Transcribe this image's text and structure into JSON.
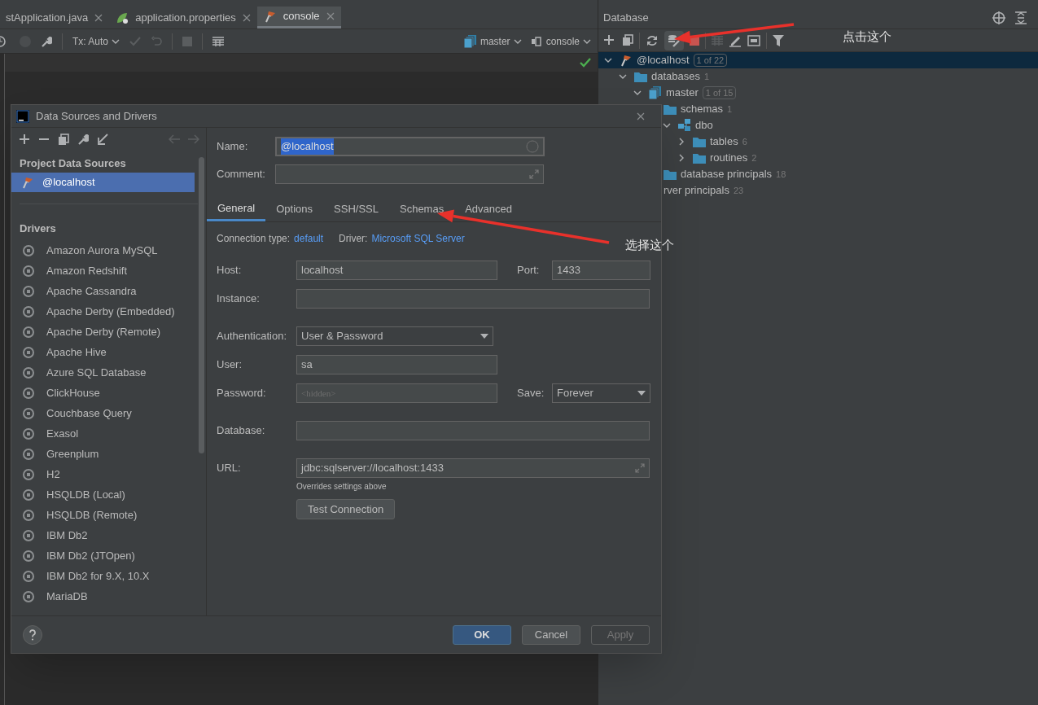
{
  "editor": {
    "tabs": [
      {
        "label": "stApplication.java",
        "kind": "java",
        "selected": false
      },
      {
        "label": "application.properties",
        "kind": "spring",
        "selected": false
      },
      {
        "label": "console",
        "kind": "console",
        "selected": true
      }
    ],
    "toolbar": {
      "transaction": "Tx: Auto",
      "schema": "master",
      "session": "console"
    }
  },
  "database_panel": {
    "title": "Database",
    "tree": [
      {
        "label": "@localhost",
        "kind": "datasource",
        "badge": "1 of 22",
        "expanded": true,
        "selected": true,
        "children": [
          {
            "label": "databases",
            "kind": "folder",
            "count": "1",
            "expanded": true,
            "selected": false,
            "children": [
              {
                "label": "master",
                "kind": "database",
                "badge": "1 of 15",
                "expanded": true,
                "selected": false,
                "children": [
                  {
                    "label": "schemas",
                    "kind": "folder",
                    "count": "1",
                    "selected": false,
                    "children": [
                      {
                        "label": "dbo",
                        "kind": "schema",
                        "expanded": true,
                        "selected": false,
                        "children": [
                          {
                            "label": "tables",
                            "kind": "folder",
                            "count": "6",
                            "expanded": false,
                            "selected": false
                          },
                          {
                            "label": "routines",
                            "kind": "folder",
                            "count": "2",
                            "expanded": false,
                            "selected": false
                          }
                        ]
                      }
                    ]
                  },
                  {
                    "label": "database principals",
                    "kind": "folder",
                    "count": "18",
                    "selected": false
                  }
                ]
              }
            ]
          },
          {
            "label": "rver principals",
            "kind": "clipped",
            "count": "23",
            "selected": false
          }
        ]
      }
    ]
  },
  "dialog": {
    "title": "Data Sources and Drivers",
    "project_header": "Project Data Sources",
    "data_sources": [
      {
        "label": "@localhost",
        "selected": true
      }
    ],
    "drivers_header": "Drivers",
    "drivers": [
      "Amazon Aurora MySQL",
      "Amazon Redshift",
      "Apache Cassandra",
      "Apache Derby (Embedded)",
      "Apache Derby (Remote)",
      "Apache Hive",
      "Azure SQL Database",
      "ClickHouse",
      "Couchbase Query",
      "Exasol",
      "Greenplum",
      "H2",
      "HSQLDB (Local)",
      "HSQLDB (Remote)",
      "IBM Db2",
      "IBM Db2 (JTOpen)",
      "IBM Db2 for 9.X, 10.X",
      "MariaDB"
    ],
    "name": {
      "label": "Name:",
      "value": "@localhost",
      "focused": true
    },
    "comment": {
      "label": "Comment:"
    },
    "tabs": [
      {
        "label": "General",
        "selected": true
      },
      {
        "label": "Options",
        "selected": false
      },
      {
        "label": "SSH/SSL",
        "selected": false
      },
      {
        "label": "Schemas",
        "selected": false
      },
      {
        "label": "Advanced",
        "selected": false
      }
    ],
    "connection_type": {
      "label": "Connection type:",
      "value": "default"
    },
    "driver": {
      "label": "Driver:",
      "value": "Microsoft SQL Server"
    },
    "host": {
      "label": "Host:",
      "value": "localhost"
    },
    "port": {
      "label": "Port:",
      "value": "1433"
    },
    "instance": {
      "label": "Instance:"
    },
    "authentication": {
      "label": "Authentication:",
      "value": "User & Password"
    },
    "user": {
      "label": "User:",
      "value": "sa"
    },
    "password": {
      "label": "Password:",
      "placeholder": "<hidden>"
    },
    "save": {
      "label": "Save:",
      "value": "Forever"
    },
    "database": {
      "label": "Database:"
    },
    "url": {
      "label": "URL:",
      "value": "jdbc:sqlserver://localhost:1433",
      "hint": "Overrides settings above"
    },
    "test_button": "Test Connection",
    "buttons": [
      {
        "label": "OK",
        "kind": "primary"
      },
      {
        "label": "Cancel",
        "kind": "normal"
      },
      {
        "label": "Apply",
        "kind": "disabled"
      }
    ]
  },
  "annotations": [
    "点击这个",
    "选择这个"
  ]
}
